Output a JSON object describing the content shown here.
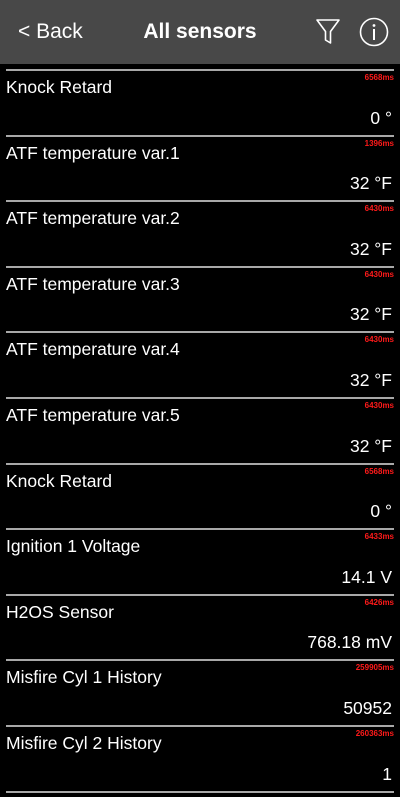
{
  "header": {
    "back_label": "< Back",
    "title": "All sensors",
    "filter_icon": "filter-icon",
    "info_icon": "info-icon"
  },
  "colors": {
    "header_bg": "#484848",
    "background": "#000000",
    "timestamp": "#ff1a1a",
    "divider": "#a8a8a8"
  },
  "sensors": [
    {
      "name": "Knock Retard",
      "time": "6568ms",
      "value": "0 °"
    },
    {
      "name": "ATF temperature var.1",
      "time": "1396ms",
      "value": "32 °F"
    },
    {
      "name": "ATF temperature var.2",
      "time": "6430ms",
      "value": "32 °F"
    },
    {
      "name": "ATF temperature var.3",
      "time": "6430ms",
      "value": "32 °F"
    },
    {
      "name": "ATF temperature var.4",
      "time": "6430ms",
      "value": "32 °F"
    },
    {
      "name": "ATF temperature var.5",
      "time": "6430ms",
      "value": "32 °F"
    },
    {
      "name": "Knock Retard",
      "time": "6568ms",
      "value": "0 °"
    },
    {
      "name": "Ignition 1 Voltage",
      "time": "6433ms",
      "value": "14.1 V"
    },
    {
      "name": "H2OS Sensor",
      "time": "6426ms",
      "value": "768.18 mV"
    },
    {
      "name": "Misfire Cyl 1 History",
      "time": "259905ms",
      "value": "50952"
    },
    {
      "name": "Misfire Cyl 2 History",
      "time": "260363ms",
      "value": "1"
    }
  ]
}
